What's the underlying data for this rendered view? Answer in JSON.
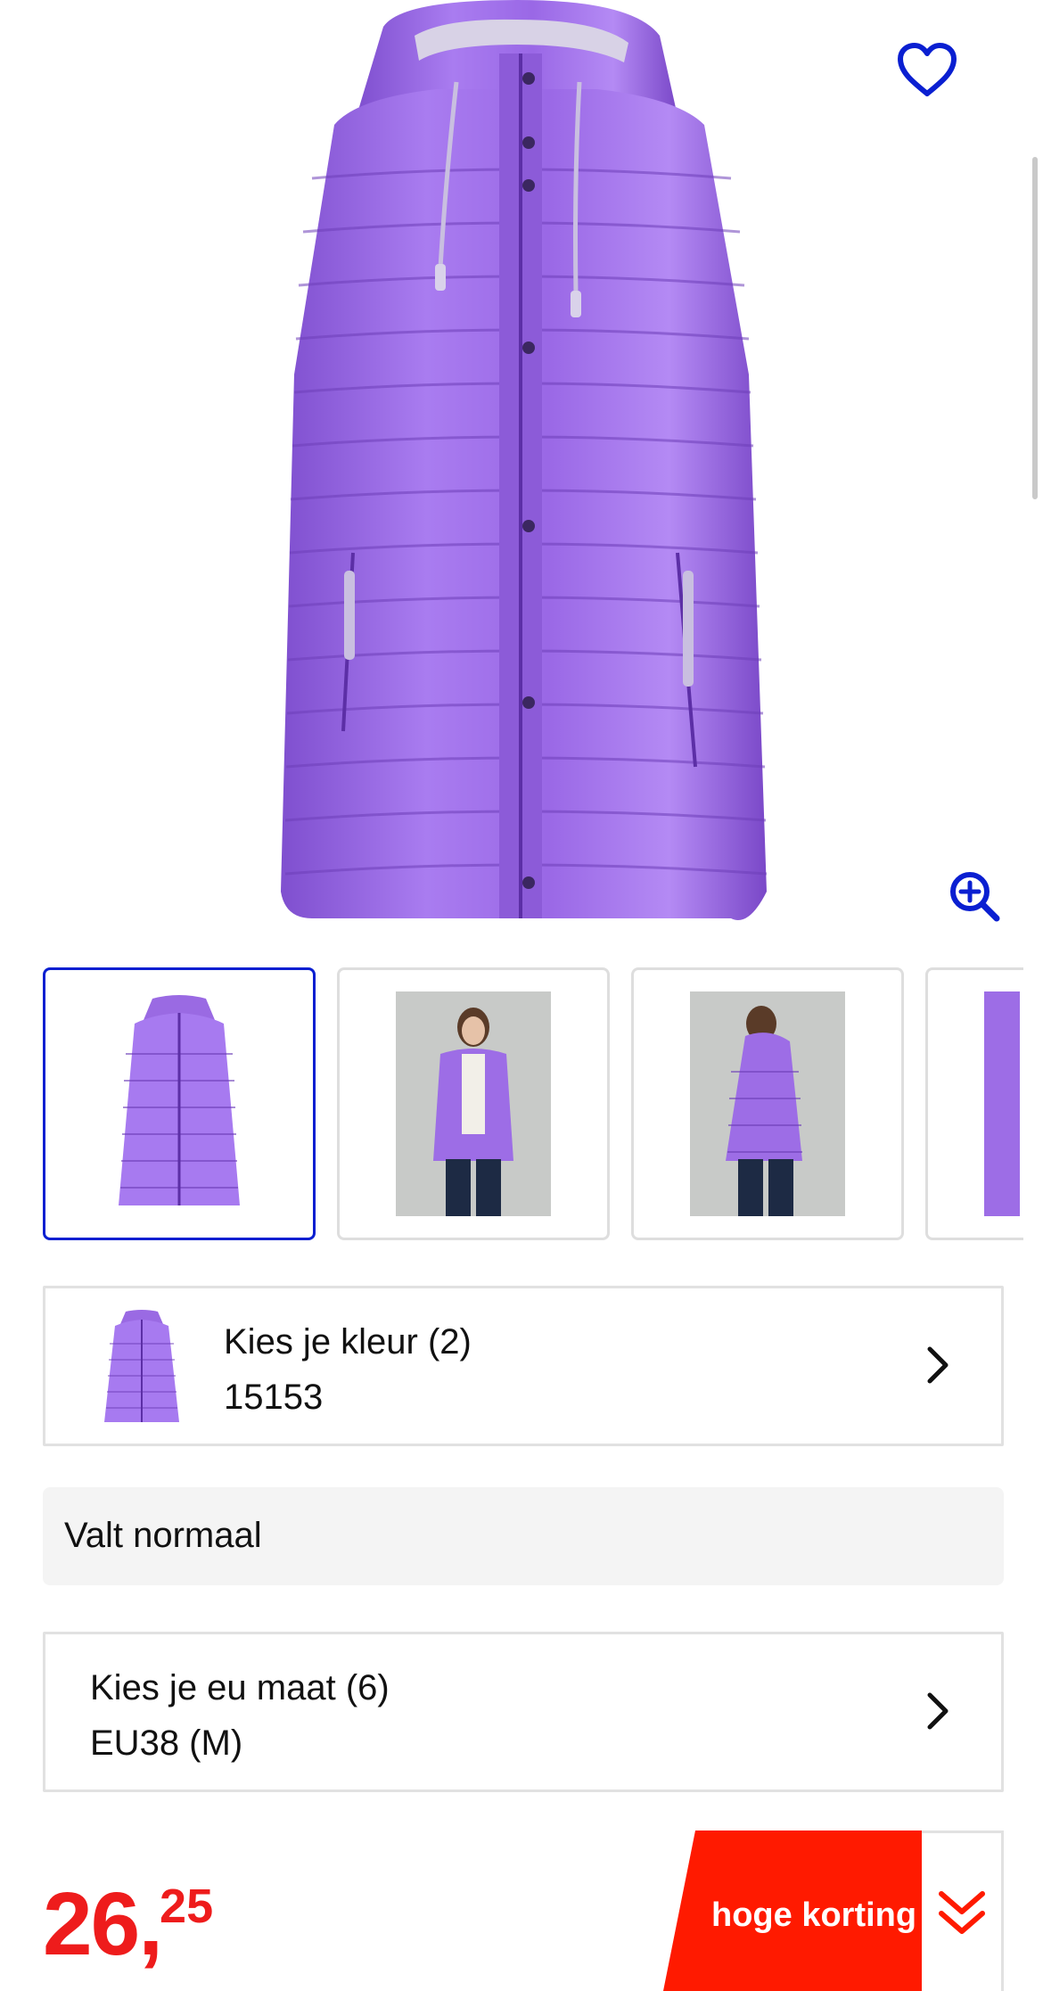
{
  "product": {
    "image_alt": "purple quilted puffer jacket with hood",
    "favorite_icon": "heart-outline-icon",
    "zoom_icon": "zoom-in-icon"
  },
  "thumbnails": [
    {
      "name": "jacket-front",
      "selected": true
    },
    {
      "name": "model-front",
      "selected": false
    },
    {
      "name": "model-back",
      "selected": false
    },
    {
      "name": "detail",
      "selected": false
    }
  ],
  "color_option": {
    "label": "Kies je kleur (2)",
    "value": "15153"
  },
  "fit": {
    "text": "Valt normaal"
  },
  "size_option": {
    "label": "Kies je eu maat (6)",
    "value": "EU38 (M)"
  },
  "price": {
    "integer": "26",
    "separator": ",",
    "decimals": "25"
  },
  "discount": {
    "label": "hoge korting"
  },
  "colors": {
    "accent_blue": "#0a1fd1",
    "price_red": "#ee1c1c",
    "badge_red": "#ff1a00",
    "jacket_purple": "#9b6ae3"
  }
}
